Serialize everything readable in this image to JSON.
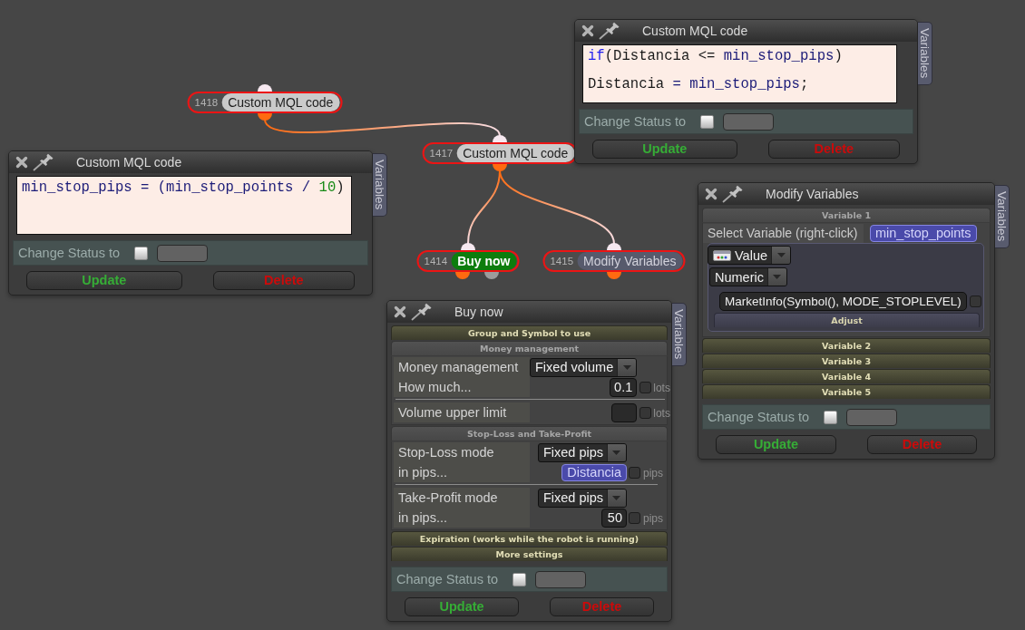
{
  "nodes": [
    {
      "number": "1418",
      "label": "Custom MQL code",
      "kind": "code",
      "children": [
        {
          "number": "1417",
          "label": "Custom MQL code",
          "kind": "code",
          "children": [
            {
              "number": "1414",
              "label": "Buy now",
              "kind": "trade"
            },
            {
              "number": "1415",
              "label": "Modify Variables",
              "kind": "variables"
            }
          ]
        }
      ]
    }
  ],
  "windows": [
    {
      "kind": "code",
      "title": "Custom MQL code",
      "side_tab": "Variables",
      "code": [
        {
          "text": "if",
          "kind": "keyword"
        },
        {
          "text": "(Distancia <= ",
          "kind": "plain"
        },
        {
          "text": "min_stop_pips",
          "kind": "ident"
        },
        {
          "text": ")\n\nDistancia",
          "kind": "plain"
        },
        {
          "text": " = min_stop_pips",
          "kind": "ident"
        },
        {
          "text": ";",
          "kind": "plain"
        }
      ],
      "status": {
        "label": "Change Status to",
        "checked": false
      },
      "buttons": [
        {
          "label": "Update",
          "kind": "update"
        },
        {
          "label": "Delete",
          "kind": "delete"
        }
      ]
    },
    {
      "kind": "code",
      "title": "Custom MQL code",
      "side_tab": "Variables",
      "code": [
        {
          "text": "min_stop_pips = (min_stop_points / ",
          "kind": "ident"
        },
        {
          "text": "10",
          "kind": "number"
        },
        {
          "text": ")",
          "kind": "plain"
        }
      ],
      "status": {
        "label": "Change Status to",
        "checked": false
      },
      "buttons": [
        {
          "label": "Update",
          "kind": "update"
        },
        {
          "label": "Delete",
          "kind": "delete"
        }
      ]
    },
    {
      "kind": "form",
      "title": "Modify Variables",
      "side_tab": "Variables",
      "sections": [
        {
          "title": "Variable 1",
          "expanded": true,
          "select": {
            "label": "Select Variable (right-click)",
            "value": "min_stop_points"
          },
          "source": {
            "type": "Value",
            "format": "Numeric",
            "expression": "MarketInfo(Symbol(), MODE_STOPLEVEL)",
            "checked": false,
            "adjust": {
              "title": "Adjust",
              "expanded": false
            }
          }
        },
        {
          "title": "Variable 2",
          "expanded": false
        },
        {
          "title": "Variable 3",
          "expanded": false
        },
        {
          "title": "Variable 4",
          "expanded": false
        },
        {
          "title": "Variable 5",
          "expanded": false
        }
      ],
      "status": {
        "label": "Change Status to",
        "checked": false
      },
      "buttons": [
        {
          "label": "Update",
          "kind": "update"
        },
        {
          "label": "Delete",
          "kind": "delete"
        }
      ]
    },
    {
      "kind": "form",
      "title": "Buy now",
      "side_tab": "Variables",
      "sections": [
        {
          "title": "Group and Symbol to use",
          "expanded": false
        },
        {
          "title": "Money management",
          "expanded": true,
          "groups": [
            {
              "rows": [
                {
                  "kind": "dropdown",
                  "label": "Money management",
                  "value": "Fixed volume"
                },
                {
                  "kind": "number",
                  "label": "How much...",
                  "value": "0.1",
                  "checked": false,
                  "unit": "lots"
                }
              ]
            },
            {
              "rows": [
                {
                  "kind": "number",
                  "label": "Volume upper limit",
                  "checked": false,
                  "unit": "lots"
                }
              ]
            }
          ]
        },
        {
          "title": "Stop-Loss and Take-Profit",
          "expanded": true,
          "groups": [
            {
              "rows": [
                {
                  "kind": "dropdown",
                  "label": "Stop-Loss mode",
                  "value": "Fixed pips"
                },
                {
                  "kind": "variable",
                  "label": "in pips...",
                  "value": "Distancia",
                  "checked": false,
                  "unit": "pips"
                }
              ]
            },
            {
              "rows": [
                {
                  "kind": "dropdown",
                  "label": "Take-Profit mode",
                  "value": "Fixed pips"
                },
                {
                  "kind": "number",
                  "label": "in pips...",
                  "value": "50",
                  "checked": false,
                  "unit": "pips"
                }
              ]
            }
          ]
        },
        {
          "title": "Expiration (works while the robot is running)",
          "expanded": false
        },
        {
          "title": "More settings",
          "expanded": false
        }
      ],
      "status": {
        "label": "Change Status to",
        "checked": false
      },
      "buttons": [
        {
          "label": "Update",
          "kind": "update"
        },
        {
          "label": "Delete",
          "kind": "delete"
        }
      ]
    }
  ]
}
